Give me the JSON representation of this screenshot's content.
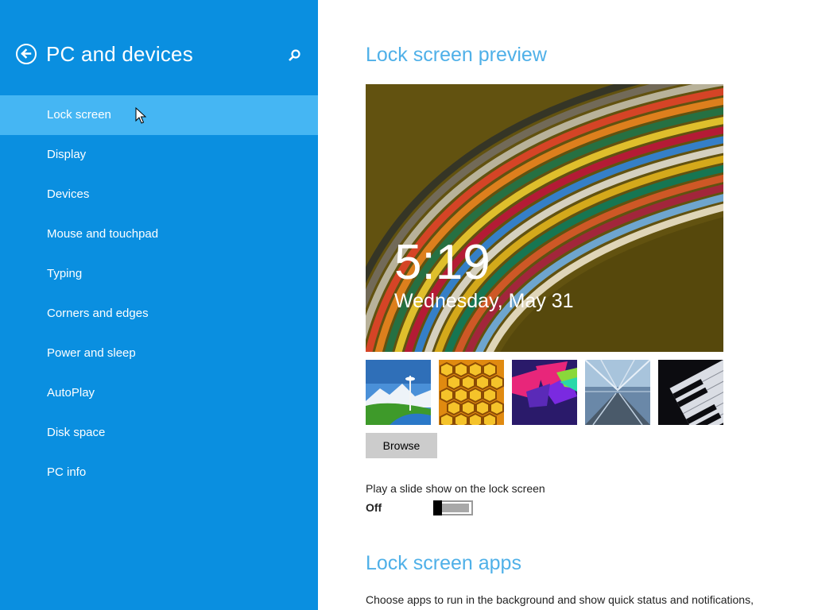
{
  "sidebar": {
    "title": "PC and devices",
    "back_icon": "back-arrow-icon",
    "search_icon": "search-icon",
    "items": [
      {
        "label": "Lock screen",
        "selected": true
      },
      {
        "label": "Display"
      },
      {
        "label": "Devices"
      },
      {
        "label": "Mouse and touchpad"
      },
      {
        "label": "Typing"
      },
      {
        "label": "Corners and edges"
      },
      {
        "label": "Power and sleep"
      },
      {
        "label": "AutoPlay"
      },
      {
        "label": "Disk space"
      },
      {
        "label": "PC info"
      }
    ]
  },
  "main": {
    "preview_title": "Lock screen preview",
    "preview": {
      "time": "5:19",
      "date": "Wednesday, May 31"
    },
    "thumbnails": [
      "space-needle-landscape",
      "honeycomb",
      "colorful-geometric",
      "train-tunnel",
      "piano-keys"
    ],
    "browse_label": "Browse",
    "slideshow": {
      "label": "Play a slide show on the lock screen",
      "state": "Off",
      "on": false
    },
    "apps_title": "Lock screen apps",
    "apps_description": "Choose apps to run in the background and show quick status and notifications,"
  },
  "colors": {
    "sidebar_bg": "#0a8fe0",
    "sidebar_selected": "#45b6f3",
    "heading_accent": "#4fb0e8"
  }
}
